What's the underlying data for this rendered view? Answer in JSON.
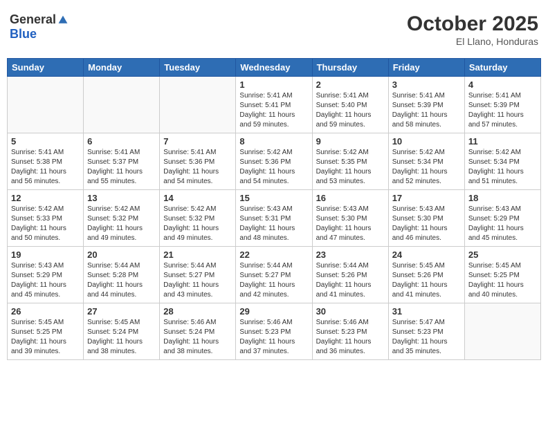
{
  "header": {
    "logo_general": "General",
    "logo_blue": "Blue",
    "month_title": "October 2025",
    "subtitle": "El Llano, Honduras"
  },
  "weekdays": [
    "Sunday",
    "Monday",
    "Tuesday",
    "Wednesday",
    "Thursday",
    "Friday",
    "Saturday"
  ],
  "weeks": [
    [
      {
        "day": "",
        "info": ""
      },
      {
        "day": "",
        "info": ""
      },
      {
        "day": "",
        "info": ""
      },
      {
        "day": "1",
        "info": "Sunrise: 5:41 AM\nSunset: 5:41 PM\nDaylight: 11 hours\nand 59 minutes."
      },
      {
        "day": "2",
        "info": "Sunrise: 5:41 AM\nSunset: 5:40 PM\nDaylight: 11 hours\nand 59 minutes."
      },
      {
        "day": "3",
        "info": "Sunrise: 5:41 AM\nSunset: 5:39 PM\nDaylight: 11 hours\nand 58 minutes."
      },
      {
        "day": "4",
        "info": "Sunrise: 5:41 AM\nSunset: 5:39 PM\nDaylight: 11 hours\nand 57 minutes."
      }
    ],
    [
      {
        "day": "5",
        "info": "Sunrise: 5:41 AM\nSunset: 5:38 PM\nDaylight: 11 hours\nand 56 minutes."
      },
      {
        "day": "6",
        "info": "Sunrise: 5:41 AM\nSunset: 5:37 PM\nDaylight: 11 hours\nand 55 minutes."
      },
      {
        "day": "7",
        "info": "Sunrise: 5:41 AM\nSunset: 5:36 PM\nDaylight: 11 hours\nand 54 minutes."
      },
      {
        "day": "8",
        "info": "Sunrise: 5:42 AM\nSunset: 5:36 PM\nDaylight: 11 hours\nand 54 minutes."
      },
      {
        "day": "9",
        "info": "Sunrise: 5:42 AM\nSunset: 5:35 PM\nDaylight: 11 hours\nand 53 minutes."
      },
      {
        "day": "10",
        "info": "Sunrise: 5:42 AM\nSunset: 5:34 PM\nDaylight: 11 hours\nand 52 minutes."
      },
      {
        "day": "11",
        "info": "Sunrise: 5:42 AM\nSunset: 5:34 PM\nDaylight: 11 hours\nand 51 minutes."
      }
    ],
    [
      {
        "day": "12",
        "info": "Sunrise: 5:42 AM\nSunset: 5:33 PM\nDaylight: 11 hours\nand 50 minutes."
      },
      {
        "day": "13",
        "info": "Sunrise: 5:42 AM\nSunset: 5:32 PM\nDaylight: 11 hours\nand 49 minutes."
      },
      {
        "day": "14",
        "info": "Sunrise: 5:42 AM\nSunset: 5:32 PM\nDaylight: 11 hours\nand 49 minutes."
      },
      {
        "day": "15",
        "info": "Sunrise: 5:43 AM\nSunset: 5:31 PM\nDaylight: 11 hours\nand 48 minutes."
      },
      {
        "day": "16",
        "info": "Sunrise: 5:43 AM\nSunset: 5:30 PM\nDaylight: 11 hours\nand 47 minutes."
      },
      {
        "day": "17",
        "info": "Sunrise: 5:43 AM\nSunset: 5:30 PM\nDaylight: 11 hours\nand 46 minutes."
      },
      {
        "day": "18",
        "info": "Sunrise: 5:43 AM\nSunset: 5:29 PM\nDaylight: 11 hours\nand 45 minutes."
      }
    ],
    [
      {
        "day": "19",
        "info": "Sunrise: 5:43 AM\nSunset: 5:29 PM\nDaylight: 11 hours\nand 45 minutes."
      },
      {
        "day": "20",
        "info": "Sunrise: 5:44 AM\nSunset: 5:28 PM\nDaylight: 11 hours\nand 44 minutes."
      },
      {
        "day": "21",
        "info": "Sunrise: 5:44 AM\nSunset: 5:27 PM\nDaylight: 11 hours\nand 43 minutes."
      },
      {
        "day": "22",
        "info": "Sunrise: 5:44 AM\nSunset: 5:27 PM\nDaylight: 11 hours\nand 42 minutes."
      },
      {
        "day": "23",
        "info": "Sunrise: 5:44 AM\nSunset: 5:26 PM\nDaylight: 11 hours\nand 41 minutes."
      },
      {
        "day": "24",
        "info": "Sunrise: 5:45 AM\nSunset: 5:26 PM\nDaylight: 11 hours\nand 41 minutes."
      },
      {
        "day": "25",
        "info": "Sunrise: 5:45 AM\nSunset: 5:25 PM\nDaylight: 11 hours\nand 40 minutes."
      }
    ],
    [
      {
        "day": "26",
        "info": "Sunrise: 5:45 AM\nSunset: 5:25 PM\nDaylight: 11 hours\nand 39 minutes."
      },
      {
        "day": "27",
        "info": "Sunrise: 5:45 AM\nSunset: 5:24 PM\nDaylight: 11 hours\nand 38 minutes."
      },
      {
        "day": "28",
        "info": "Sunrise: 5:46 AM\nSunset: 5:24 PM\nDaylight: 11 hours\nand 38 minutes."
      },
      {
        "day": "29",
        "info": "Sunrise: 5:46 AM\nSunset: 5:23 PM\nDaylight: 11 hours\nand 37 minutes."
      },
      {
        "day": "30",
        "info": "Sunrise: 5:46 AM\nSunset: 5:23 PM\nDaylight: 11 hours\nand 36 minutes."
      },
      {
        "day": "31",
        "info": "Sunrise: 5:47 AM\nSunset: 5:23 PM\nDaylight: 11 hours\nand 35 minutes."
      },
      {
        "day": "",
        "info": ""
      }
    ]
  ]
}
